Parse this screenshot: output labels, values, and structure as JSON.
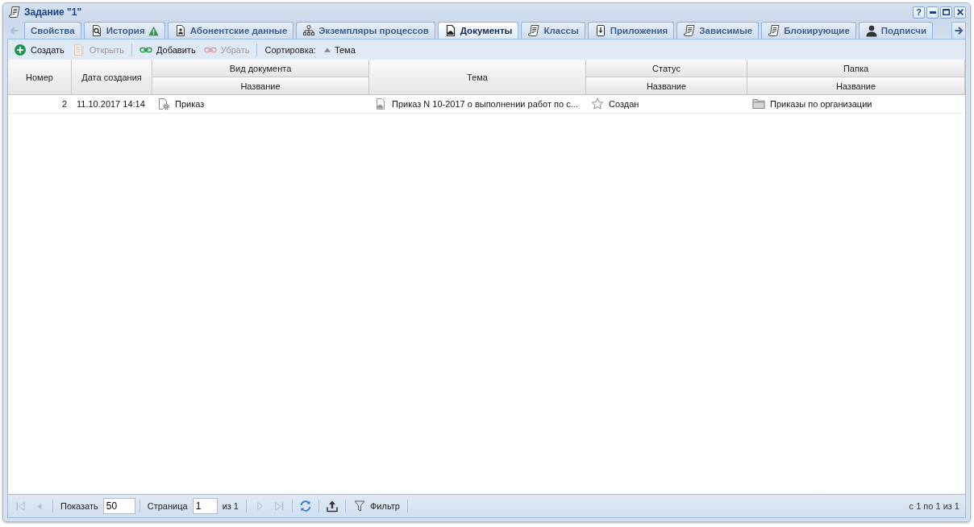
{
  "window": {
    "title": "Задание \"1\"",
    "help": "?"
  },
  "tabs": [
    {
      "label": "Свойства",
      "selected": false,
      "warning": false
    },
    {
      "label": "История",
      "selected": false,
      "warning": true
    },
    {
      "label": "Абонентские данные",
      "selected": false,
      "warning": false
    },
    {
      "label": "Экземпляры процессов",
      "selected": false,
      "warning": false
    },
    {
      "label": "Документы",
      "selected": true,
      "warning": false
    },
    {
      "label": "Классы",
      "selected": false,
      "warning": false
    },
    {
      "label": "Приложения",
      "selected": false,
      "warning": false
    },
    {
      "label": "Зависимые",
      "selected": false,
      "warning": false
    },
    {
      "label": "Блокирующие",
      "selected": false,
      "warning": false
    },
    {
      "label": "Подписчи",
      "selected": false,
      "warning": false
    }
  ],
  "toolbar": {
    "buttons": [
      {
        "label": "Создать",
        "disabled": false
      },
      {
        "label": "Открыть",
        "disabled": true
      },
      {
        "label": "Добавить",
        "disabled": false
      },
      {
        "label": "Убрать",
        "disabled": true
      }
    ],
    "sort_label": "Сортировка:",
    "sort_field": "Тема"
  },
  "table": {
    "columns": [
      {
        "title": "Номер"
      },
      {
        "title": "Дата создания"
      },
      {
        "group": "Вид документа",
        "title": "Название"
      },
      {
        "title": "Тема"
      },
      {
        "group": "Статус",
        "title": "Название"
      },
      {
        "group": "Папка",
        "title": "Название"
      }
    ],
    "rows": [
      {
        "cells": [
          "2",
          "11.10.2017 14:14",
          "Приказ",
          "Приказ N 10-2017 о выполнении работ по с...",
          "Создан",
          "Приказы по организации"
        ]
      }
    ]
  },
  "paging": {
    "nav_buttons": [
      {
        "disabled": true
      },
      {
        "disabled": true
      },
      {
        "disabled": true
      },
      {
        "disabled": true
      }
    ],
    "show_label": "Показать",
    "page_size": "50",
    "page_label": "Страница",
    "page": "1",
    "page_count": "из 1",
    "filter_label": "Фильтр",
    "summary": "с 1 по 1 из 1"
  }
}
